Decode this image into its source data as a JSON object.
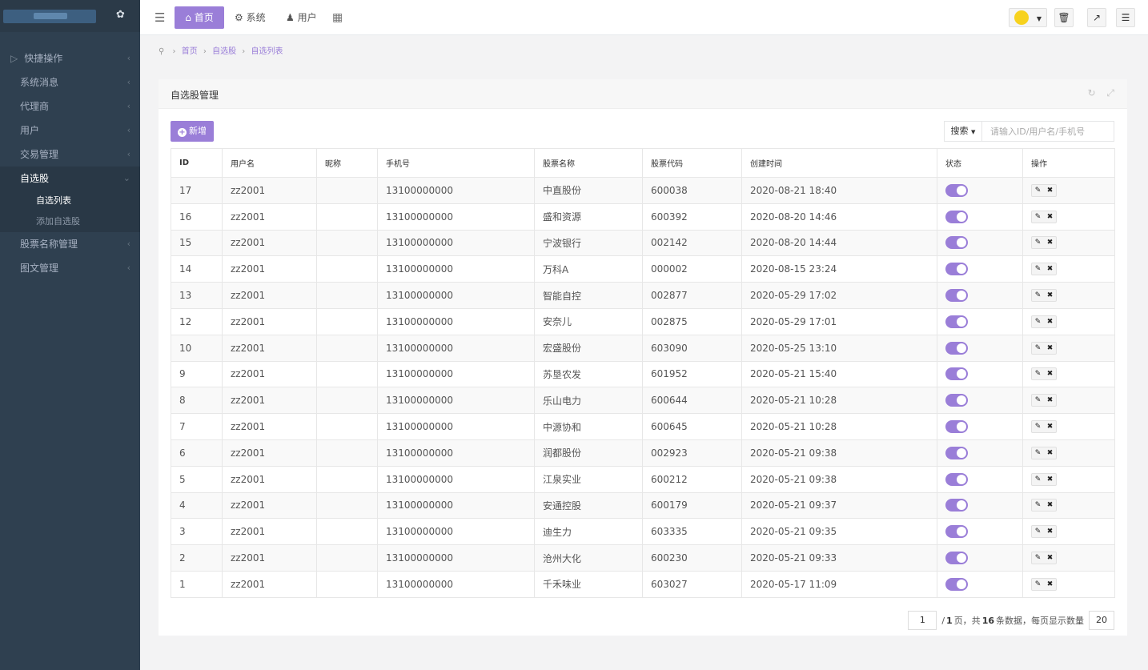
{
  "brand": {
    "icon": "drop-icon"
  },
  "sidebar": {
    "items": [
      {
        "label": "快捷操作",
        "icon": "folder-icon"
      },
      {
        "label": "系统消息"
      },
      {
        "label": "代理商"
      },
      {
        "label": "用户"
      },
      {
        "label": "交易管理"
      },
      {
        "label": "自选股",
        "active": true
      },
      {
        "label": "股票名称管理"
      },
      {
        "label": "图文管理"
      }
    ],
    "submenu": [
      {
        "label": "自选列表",
        "current": true
      },
      {
        "label": "添加自选股"
      }
    ]
  },
  "topbar": {
    "home": "首页",
    "system": "系统",
    "user": "用户"
  },
  "breadcrumb": [
    "首页",
    "自选股",
    "自选列表"
  ],
  "panel": {
    "title": "自选股管理",
    "add_label": "新增",
    "search_label": "搜索",
    "search_placeholder": "请输入ID/用户名/手机号"
  },
  "table": {
    "headers": [
      "ID",
      "用户名",
      "昵称",
      "手机号",
      "股票名称",
      "股票代码",
      "创建时间",
      "状态",
      "操作"
    ],
    "rows": [
      {
        "id": "17",
        "user": "zz2001",
        "nick": "",
        "phone": "13100000000",
        "name": "中直股份",
        "code": "600038",
        "time": "2020-08-21 18:40"
      },
      {
        "id": "16",
        "user": "zz2001",
        "nick": "",
        "phone": "13100000000",
        "name": "盛和资源",
        "code": "600392",
        "time": "2020-08-20 14:46"
      },
      {
        "id": "15",
        "user": "zz2001",
        "nick": "",
        "phone": "13100000000",
        "name": "宁波银行",
        "code": "002142",
        "time": "2020-08-20 14:44"
      },
      {
        "id": "14",
        "user": "zz2001",
        "nick": "",
        "phone": "13100000000",
        "name": "万科A",
        "code": "000002",
        "time": "2020-08-15 23:24"
      },
      {
        "id": "13",
        "user": "zz2001",
        "nick": "",
        "phone": "13100000000",
        "name": "智能自控",
        "code": "002877",
        "time": "2020-05-29 17:02"
      },
      {
        "id": "12",
        "user": "zz2001",
        "nick": "",
        "phone": "13100000000",
        "name": "安奈儿",
        "code": "002875",
        "time": "2020-05-29 17:01"
      },
      {
        "id": "10",
        "user": "zz2001",
        "nick": "",
        "phone": "13100000000",
        "name": "宏盛股份",
        "code": "603090",
        "time": "2020-05-25 13:10"
      },
      {
        "id": "9",
        "user": "zz2001",
        "nick": "",
        "phone": "13100000000",
        "name": "苏垦农发",
        "code": "601952",
        "time": "2020-05-21 15:40"
      },
      {
        "id": "8",
        "user": "zz2001",
        "nick": "",
        "phone": "13100000000",
        "name": "乐山电力",
        "code": "600644",
        "time": "2020-05-21 10:28"
      },
      {
        "id": "7",
        "user": "zz2001",
        "nick": "",
        "phone": "13100000000",
        "name": "中源协和",
        "code": "600645",
        "time": "2020-05-21 10:28"
      },
      {
        "id": "6",
        "user": "zz2001",
        "nick": "",
        "phone": "13100000000",
        "name": "润都股份",
        "code": "002923",
        "time": "2020-05-21 09:38"
      },
      {
        "id": "5",
        "user": "zz2001",
        "nick": "",
        "phone": "13100000000",
        "name": "江泉实业",
        "code": "600212",
        "time": "2020-05-21 09:38"
      },
      {
        "id": "4",
        "user": "zz2001",
        "nick": "",
        "phone": "13100000000",
        "name": "安通控股",
        "code": "600179",
        "time": "2020-05-21 09:37"
      },
      {
        "id": "3",
        "user": "zz2001",
        "nick": "",
        "phone": "13100000000",
        "name": "迪生力",
        "code": "603335",
        "time": "2020-05-21 09:35"
      },
      {
        "id": "2",
        "user": "zz2001",
        "nick": "",
        "phone": "13100000000",
        "name": "沧州大化",
        "code": "600230",
        "time": "2020-05-21 09:33"
      },
      {
        "id": "1",
        "user": "zz2001",
        "nick": "",
        "phone": "13100000000",
        "name": "千禾味业",
        "code": "603027",
        "time": "2020-05-17 11:09"
      }
    ]
  },
  "pager": {
    "page": "1",
    "pre_total": "/",
    "total_pages": "1",
    "mid1": "页，共",
    "total_count": "16",
    "mid2": "条数据，每页显示数量",
    "page_size": "20"
  },
  "colors": {
    "accent": "#9a7ed8",
    "sidebar": "#2f4050"
  }
}
